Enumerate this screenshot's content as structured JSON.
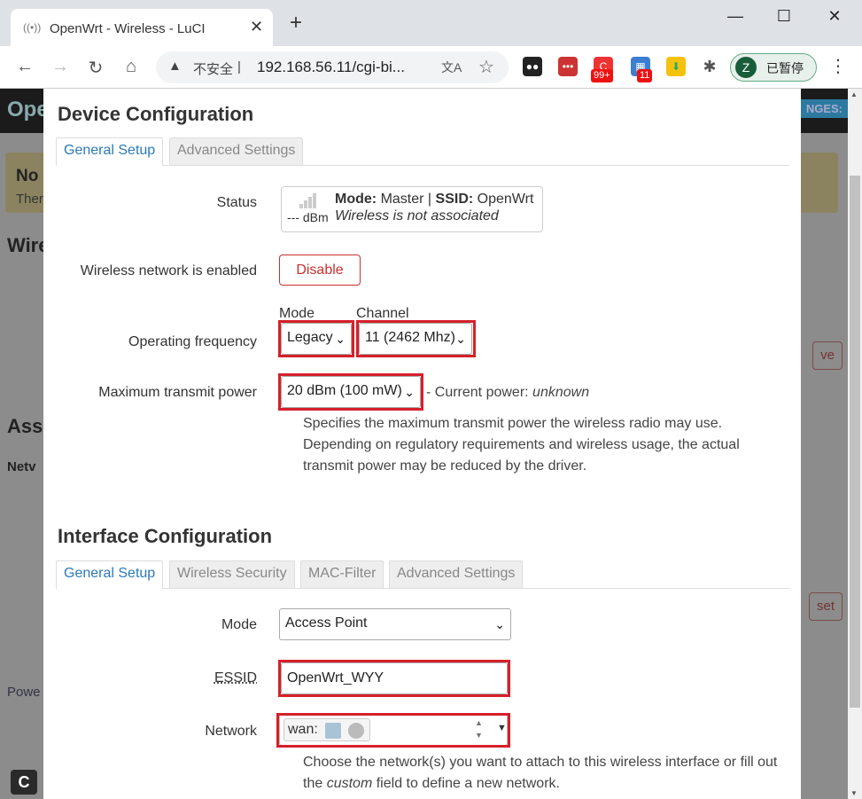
{
  "browser": {
    "tab_title": "OpenWrt - Wireless - LuCI",
    "insecure_label": "不安全",
    "url": "192.168.56.11/cgi-bi...",
    "profile_initial": "Z",
    "profile_label": "已暂停",
    "badge_99": "99+",
    "badge_11": "11"
  },
  "background": {
    "header_text": "Ope",
    "changes_text": "NGES:",
    "warn_title": "No",
    "warn_text": "Ther",
    "heading_wire": "Wire",
    "heading_ass": "Ass",
    "net_col": "Netv",
    "btn_remove": "ve",
    "btn_reset": "set",
    "footer_link": "Powe",
    "corner_btn": "C"
  },
  "device_config": {
    "title": "Device Configuration",
    "tabs": [
      "General Setup",
      "Advanced Settings"
    ],
    "status": {
      "label": "Status",
      "dbm": "--- dBm",
      "mode_key": "Mode:",
      "mode_value": "Master",
      "sep": "|",
      "ssid_key": "SSID:",
      "ssid_value": "OpenWrt",
      "assoc": "Wireless is not associated"
    },
    "enabled": {
      "label": "Wireless network is enabled",
      "button": "Disable"
    },
    "frequency": {
      "label": "Operating frequency",
      "mode_label": "Mode",
      "mode_value": "Legacy",
      "channel_label": "Channel",
      "channel_value": "11 (2462 Mhz)"
    },
    "txpower": {
      "label": "Maximum transmit power",
      "value": "20 dBm (100 mW)",
      "current_prefix": "- Current power:",
      "current_value": "unknown",
      "help": "Specifies the maximum transmit power the wireless radio may use. Depending on regulatory requirements and wireless usage, the actual transmit power may be reduced by the driver."
    }
  },
  "interface_config": {
    "title": "Interface Configuration",
    "tabs": [
      "General Setup",
      "Wireless Security",
      "MAC-Filter",
      "Advanced Settings"
    ],
    "mode": {
      "label": "Mode",
      "value": "Access Point"
    },
    "essid": {
      "label": "ESSID",
      "value": "OpenWrt_WYY"
    },
    "network": {
      "label": "Network",
      "chip": "wan:",
      "help_pre": "Choose the network(s) you want to attach to this wireless interface or fill out the",
      "help_em": "custom",
      "help_post": "field to define a new network."
    }
  },
  "colors": {
    "highlight": "#d6202a",
    "tab_active": "#2a7ab8",
    "danger": "#c9302c"
  }
}
